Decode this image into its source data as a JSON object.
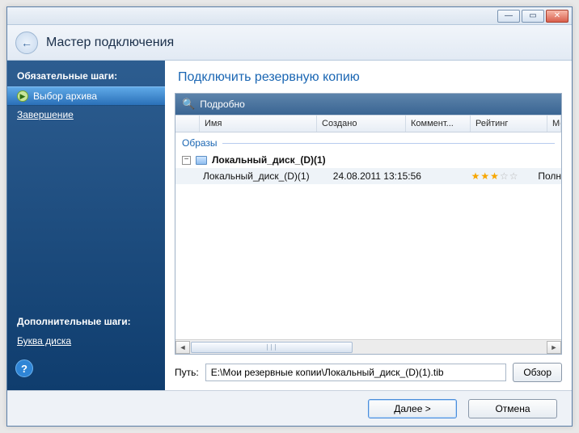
{
  "window": {
    "title": "Мастер подключения"
  },
  "sidebar": {
    "required_heading": "Обязательные шаги:",
    "additional_heading": "Дополнительные шаги:",
    "items": [
      {
        "label": "Выбор архива",
        "active": true
      },
      {
        "label": "Завершение",
        "active": false
      }
    ],
    "additional_items": [
      {
        "label": "Буква диска"
      }
    ]
  },
  "main": {
    "title": "Подключить резервную копию",
    "details_label": "Подробно",
    "columns": {
      "name": "Имя",
      "created": "Создано",
      "comment": "Коммент...",
      "rating": "Рейтинг",
      "method": "Ме"
    },
    "group_label": "Образы",
    "tree": {
      "parent_name": "Локальный_диск_(D)(1)",
      "entry": {
        "name": "Локальный_диск_(D)(1)",
        "date": "24.08.2011 13:15:56",
        "rating": 3,
        "method": "Полн"
      }
    }
  },
  "path": {
    "label": "Путь:",
    "value": "E:\\Мои резервные копии\\Локальный_диск_(D)(1).tib",
    "browse": "Обзор"
  },
  "footer": {
    "next": "Далее >",
    "cancel": "Отмена"
  }
}
